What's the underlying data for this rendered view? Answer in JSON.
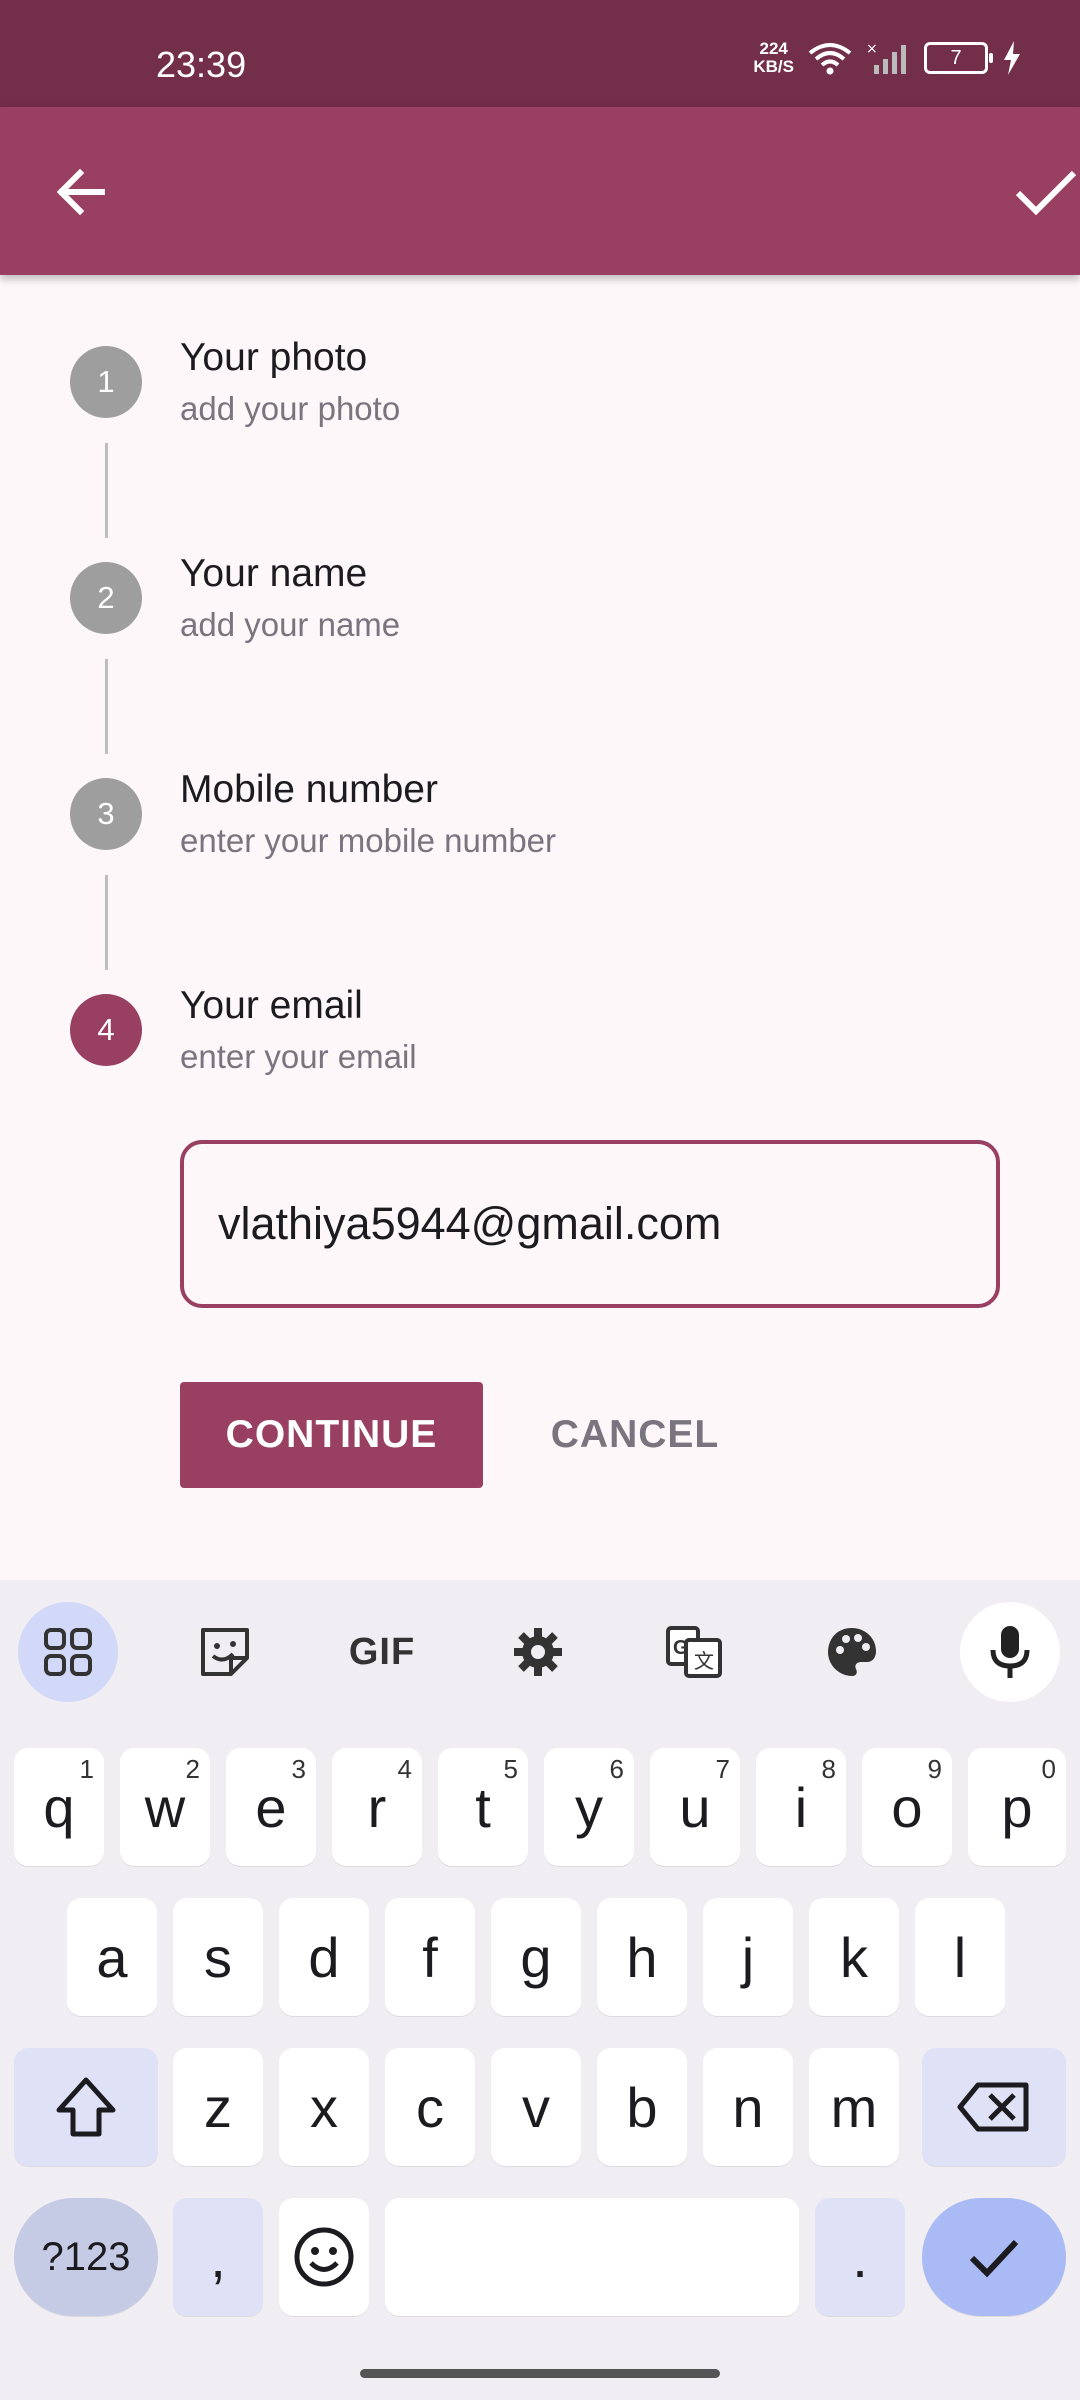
{
  "status_bar": {
    "time": "23:39",
    "net_speed_value": "224",
    "net_speed_unit": "KB/S",
    "battery": "7"
  },
  "app_bar": {
    "back_icon": "arrow-back-icon",
    "confirm_icon": "check-icon"
  },
  "steps": [
    {
      "number": "1",
      "title": "Your photo",
      "subtitle": "add your photo",
      "active": false
    },
    {
      "number": "2",
      "title": "Your name",
      "subtitle": "add your name",
      "active": false
    },
    {
      "number": "3",
      "title": "Mobile number",
      "subtitle": "enter your mobile number",
      "active": false
    },
    {
      "number": "4",
      "title": "Your email",
      "subtitle": "enter your email",
      "active": true
    }
  ],
  "email_input": {
    "value": "vlathiya5944@gmail.com"
  },
  "buttons": {
    "continue": "CONTINUE",
    "cancel": "CANCEL"
  },
  "keyboard": {
    "toolbar": {
      "gif": "GIF"
    },
    "rows": {
      "row1": [
        {
          "key": "q",
          "hint": "1"
        },
        {
          "key": "w",
          "hint": "2"
        },
        {
          "key": "e",
          "hint": "3"
        },
        {
          "key": "r",
          "hint": "4"
        },
        {
          "key": "t",
          "hint": "5"
        },
        {
          "key": "y",
          "hint": "6"
        },
        {
          "key": "u",
          "hint": "7"
        },
        {
          "key": "i",
          "hint": "8"
        },
        {
          "key": "o",
          "hint": "9"
        },
        {
          "key": "p",
          "hint": "0"
        }
      ],
      "row2": [
        "a",
        "s",
        "d",
        "f",
        "g",
        "h",
        "j",
        "k",
        "l"
      ],
      "row3": [
        "z",
        "x",
        "c",
        "v",
        "b",
        "n",
        "m"
      ]
    },
    "symbols": "?123",
    "comma": ",",
    "period": "."
  },
  "colors": {
    "primary": "#983f62",
    "status_bar": "#732e49",
    "inactive_step": "#9e9e9e"
  }
}
